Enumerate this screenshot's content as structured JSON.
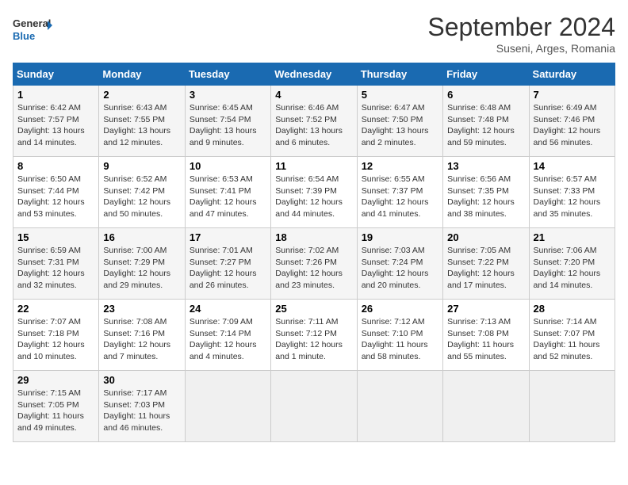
{
  "header": {
    "logo_line1": "General",
    "logo_line2": "Blue",
    "month": "September 2024",
    "location": "Suseni, Arges, Romania"
  },
  "days_of_week": [
    "Sunday",
    "Monday",
    "Tuesday",
    "Wednesday",
    "Thursday",
    "Friday",
    "Saturday"
  ],
  "weeks": [
    [
      {
        "day": "1",
        "info": "Sunrise: 6:42 AM\nSunset: 7:57 PM\nDaylight: 13 hours\nand 14 minutes."
      },
      {
        "day": "2",
        "info": "Sunrise: 6:43 AM\nSunset: 7:55 PM\nDaylight: 13 hours\nand 12 minutes."
      },
      {
        "day": "3",
        "info": "Sunrise: 6:45 AM\nSunset: 7:54 PM\nDaylight: 13 hours\nand 9 minutes."
      },
      {
        "day": "4",
        "info": "Sunrise: 6:46 AM\nSunset: 7:52 PM\nDaylight: 13 hours\nand 6 minutes."
      },
      {
        "day": "5",
        "info": "Sunrise: 6:47 AM\nSunset: 7:50 PM\nDaylight: 13 hours\nand 2 minutes."
      },
      {
        "day": "6",
        "info": "Sunrise: 6:48 AM\nSunset: 7:48 PM\nDaylight: 12 hours\nand 59 minutes."
      },
      {
        "day": "7",
        "info": "Sunrise: 6:49 AM\nSunset: 7:46 PM\nDaylight: 12 hours\nand 56 minutes."
      }
    ],
    [
      {
        "day": "8",
        "info": "Sunrise: 6:50 AM\nSunset: 7:44 PM\nDaylight: 12 hours\nand 53 minutes."
      },
      {
        "day": "9",
        "info": "Sunrise: 6:52 AM\nSunset: 7:42 PM\nDaylight: 12 hours\nand 50 minutes."
      },
      {
        "day": "10",
        "info": "Sunrise: 6:53 AM\nSunset: 7:41 PM\nDaylight: 12 hours\nand 47 minutes."
      },
      {
        "day": "11",
        "info": "Sunrise: 6:54 AM\nSunset: 7:39 PM\nDaylight: 12 hours\nand 44 minutes."
      },
      {
        "day": "12",
        "info": "Sunrise: 6:55 AM\nSunset: 7:37 PM\nDaylight: 12 hours\nand 41 minutes."
      },
      {
        "day": "13",
        "info": "Sunrise: 6:56 AM\nSunset: 7:35 PM\nDaylight: 12 hours\nand 38 minutes."
      },
      {
        "day": "14",
        "info": "Sunrise: 6:57 AM\nSunset: 7:33 PM\nDaylight: 12 hours\nand 35 minutes."
      }
    ],
    [
      {
        "day": "15",
        "info": "Sunrise: 6:59 AM\nSunset: 7:31 PM\nDaylight: 12 hours\nand 32 minutes."
      },
      {
        "day": "16",
        "info": "Sunrise: 7:00 AM\nSunset: 7:29 PM\nDaylight: 12 hours\nand 29 minutes."
      },
      {
        "day": "17",
        "info": "Sunrise: 7:01 AM\nSunset: 7:27 PM\nDaylight: 12 hours\nand 26 minutes."
      },
      {
        "day": "18",
        "info": "Sunrise: 7:02 AM\nSunset: 7:26 PM\nDaylight: 12 hours\nand 23 minutes."
      },
      {
        "day": "19",
        "info": "Sunrise: 7:03 AM\nSunset: 7:24 PM\nDaylight: 12 hours\nand 20 minutes."
      },
      {
        "day": "20",
        "info": "Sunrise: 7:05 AM\nSunset: 7:22 PM\nDaylight: 12 hours\nand 17 minutes."
      },
      {
        "day": "21",
        "info": "Sunrise: 7:06 AM\nSunset: 7:20 PM\nDaylight: 12 hours\nand 14 minutes."
      }
    ],
    [
      {
        "day": "22",
        "info": "Sunrise: 7:07 AM\nSunset: 7:18 PM\nDaylight: 12 hours\nand 10 minutes."
      },
      {
        "day": "23",
        "info": "Sunrise: 7:08 AM\nSunset: 7:16 PM\nDaylight: 12 hours\nand 7 minutes."
      },
      {
        "day": "24",
        "info": "Sunrise: 7:09 AM\nSunset: 7:14 PM\nDaylight: 12 hours\nand 4 minutes."
      },
      {
        "day": "25",
        "info": "Sunrise: 7:11 AM\nSunset: 7:12 PM\nDaylight: 12 hours\nand 1 minute."
      },
      {
        "day": "26",
        "info": "Sunrise: 7:12 AM\nSunset: 7:10 PM\nDaylight: 11 hours\nand 58 minutes."
      },
      {
        "day": "27",
        "info": "Sunrise: 7:13 AM\nSunset: 7:08 PM\nDaylight: 11 hours\nand 55 minutes."
      },
      {
        "day": "28",
        "info": "Sunrise: 7:14 AM\nSunset: 7:07 PM\nDaylight: 11 hours\nand 52 minutes."
      }
    ],
    [
      {
        "day": "29",
        "info": "Sunrise: 7:15 AM\nSunset: 7:05 PM\nDaylight: 11 hours\nand 49 minutes."
      },
      {
        "day": "30",
        "info": "Sunrise: 7:17 AM\nSunset: 7:03 PM\nDaylight: 11 hours\nand 46 minutes."
      },
      {
        "day": "",
        "info": ""
      },
      {
        "day": "",
        "info": ""
      },
      {
        "day": "",
        "info": ""
      },
      {
        "day": "",
        "info": ""
      },
      {
        "day": "",
        "info": ""
      }
    ]
  ]
}
